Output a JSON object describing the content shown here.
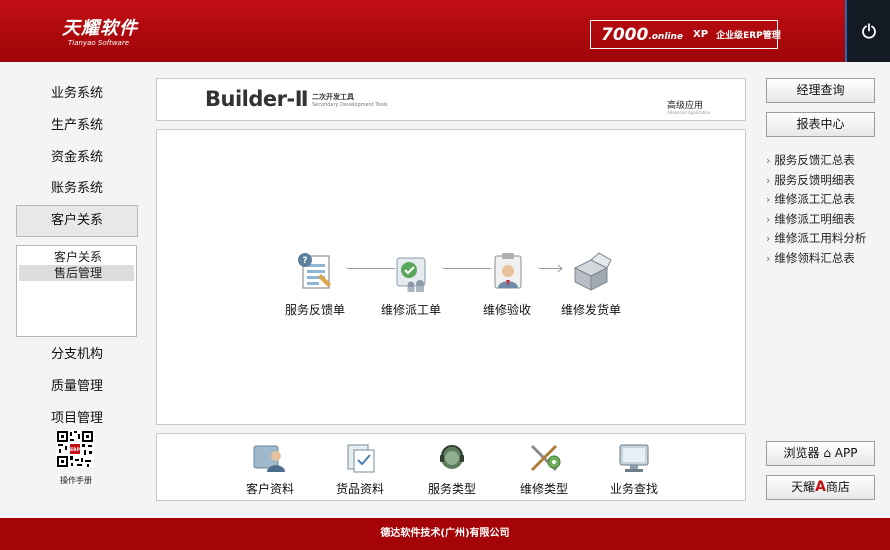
{
  "header": {
    "brand_name": "天耀软件",
    "brand_sub": "Tianyao Software",
    "badge_number": "7000",
    "badge_online": ".online",
    "badge_xp": "XP",
    "badge_erp": "企业级ERP管理",
    "power_icon": "power-icon",
    "accent_color": "#b00b10"
  },
  "sidebar": {
    "items_top": [
      "业务系统",
      "生产系统",
      "资金系统",
      "账务系统"
    ],
    "active_item": "客户关系",
    "submenu": [
      "客户关系",
      "售后管理"
    ],
    "selected_sub": "售后管理",
    "items_bottom": [
      "分支机构",
      "质量管理",
      "项目管理"
    ],
    "qr_label": "操作手册",
    "qr_badge": "ERP"
  },
  "builder": {
    "title": "Builder-Ⅱ",
    "cn_label": "二次开发工具",
    "en_label": "Secondary Development Tools",
    "advanced": "高级应用",
    "advanced_en": "Advanced Application"
  },
  "flow": {
    "items": [
      {
        "label": "服务反馈单",
        "icon": "feedback-form-icon"
      },
      {
        "label": "维修派工单",
        "icon": "dispatch-order-icon"
      },
      {
        "label": "维修验收",
        "icon": "acceptance-icon"
      },
      {
        "label": "维修发货单",
        "icon": "shipping-box-icon"
      }
    ]
  },
  "bottom_bar": {
    "items": [
      {
        "label": "客户资料",
        "icon": "customer-icon"
      },
      {
        "label": "货品资料",
        "icon": "goods-icon"
      },
      {
        "label": "服务类型",
        "icon": "headset-icon"
      },
      {
        "label": "维修类型",
        "icon": "tools-icon"
      },
      {
        "label": "业务查找",
        "icon": "monitor-search-icon"
      }
    ]
  },
  "right": {
    "btn_manager": "经理查询",
    "btn_report": "报表中心",
    "reports": [
      "服务反馈汇总表",
      "服务反馈明细表",
      "维修派工汇总表",
      "维修派工明细表",
      "维修派工用料分析",
      "维修领料汇总表"
    ],
    "report_arrow": "›",
    "btn_browser": "浏览器 ⌂ APP",
    "store_prefix": "天耀",
    "store_letter": "A",
    "store_suffix": "商店"
  },
  "footer": {
    "text": "德达软件技术(广州)有限公司"
  }
}
